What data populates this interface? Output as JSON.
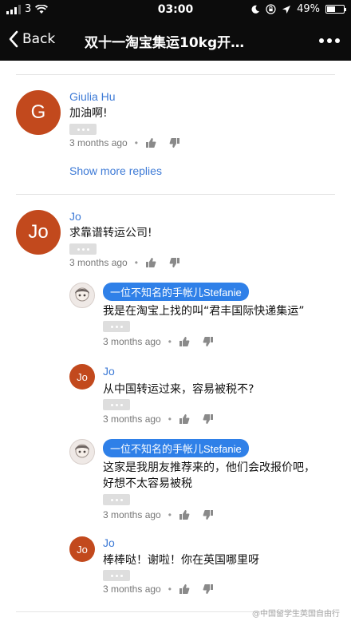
{
  "status_bar": {
    "carrier": "3",
    "time": "03:00",
    "battery": "49%",
    "battery_level": 0.49,
    "icons": [
      "signal-icon",
      "wifi-icon",
      "moon-icon",
      "lock-rotation-icon",
      "location-icon",
      "battery-icon"
    ]
  },
  "nav": {
    "back_label": "Back",
    "title": "双十一淘宝集运10kg开…"
  },
  "comments": [
    {
      "author": "Giulia Hu",
      "initial": "G",
      "text": "加油啊!",
      "time": "3 months ago"
    },
    {
      "author": "Jo",
      "initial": "Jo",
      "text": "求靠谱转运公司!",
      "time": "3 months ago"
    }
  ],
  "show_more_replies": "Show more replies",
  "replies": [
    {
      "author": "一位不知名的手帐儿Stefanie",
      "text_lines": [
        "我是在淘宝上找的叫“君丰国际快递集运”"
      ],
      "time": "3 months ago"
    },
    {
      "author": "Jo",
      "initial": "Jo",
      "text_lines": [
        "从中国转运过来，容易被税不?"
      ],
      "time": "3 months ago"
    },
    {
      "author": "一位不知名的手帐儿Stefanie",
      "text_lines": [
        "这家是我朋友推荐来的，他们会改报价吧，",
        "好想不太容易被税"
      ],
      "time": "3 months ago"
    },
    {
      "author": "Jo",
      "initial": "Jo",
      "text_lines": [
        "棒棒哒！谢啦！你在英国哪里呀"
      ],
      "time": "3 months ago"
    }
  ],
  "colors": {
    "link_blue": "#3d7ad6",
    "pill_blue": "#2f80e8",
    "avatar_orange": "#c2491d",
    "nav_black": "#0c0c0c"
  },
  "watermark": "@中国留学生英国自由行"
}
